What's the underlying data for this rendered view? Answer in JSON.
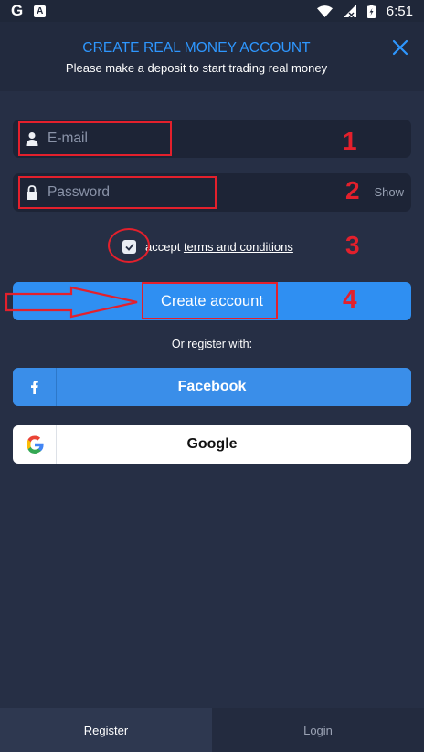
{
  "status_bar": {
    "g_label": "G",
    "a_label": "A",
    "time": "6:51",
    "icons": [
      "wifi-icon",
      "signal-icon",
      "battery-icon"
    ]
  },
  "header": {
    "title": "CREATE REAL MONEY ACCOUNT",
    "subtitle": "Please make a deposit to start trading real money",
    "title_color": "#2e97ff"
  },
  "form": {
    "email_placeholder": "E-mail",
    "password_placeholder": "Password",
    "show_label": "Show",
    "terms_prefix": "accept",
    "terms_link": "terms and conditions",
    "terms_checked": true
  },
  "buttons": {
    "create_account": "Create account",
    "or_register": "Or register with:",
    "facebook": "Facebook",
    "google": "Google"
  },
  "tabs": {
    "register": "Register",
    "login": "Login"
  },
  "annotations": {
    "step1": "1",
    "step2": "2",
    "step3": "3",
    "step4": "4",
    "color": "#e3202c"
  }
}
